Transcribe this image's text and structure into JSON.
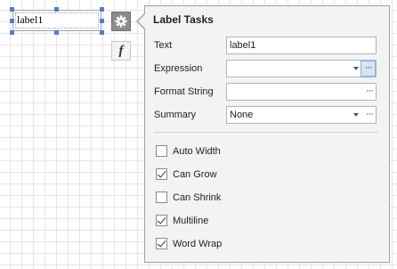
{
  "design_surface": {
    "label_control_text": "label1",
    "fx_button_glyph": "f"
  },
  "panel": {
    "title": "Label Tasks",
    "rows": {
      "text": {
        "label": "Text",
        "value": "label1"
      },
      "expression": {
        "label": "Expression",
        "value": ""
      },
      "format_string": {
        "label": "Format String",
        "value": ""
      },
      "summary": {
        "label": "Summary",
        "value": "None"
      }
    },
    "checks": [
      {
        "label": "Auto Width",
        "checked": false
      },
      {
        "label": "Can Grow",
        "checked": true
      },
      {
        "label": "Can Shrink",
        "checked": false
      },
      {
        "label": "Multiline",
        "checked": true
      },
      {
        "label": "Word Wrap",
        "checked": true
      }
    ],
    "ellipsis": "···"
  },
  "icons": {
    "smart_tag": "gear-icon",
    "expression": "function-icon"
  },
  "colors": {
    "selection_handles": "#5a7fb5",
    "panel_background": "#f3f3f3",
    "active_button": "#d7e6f6"
  }
}
